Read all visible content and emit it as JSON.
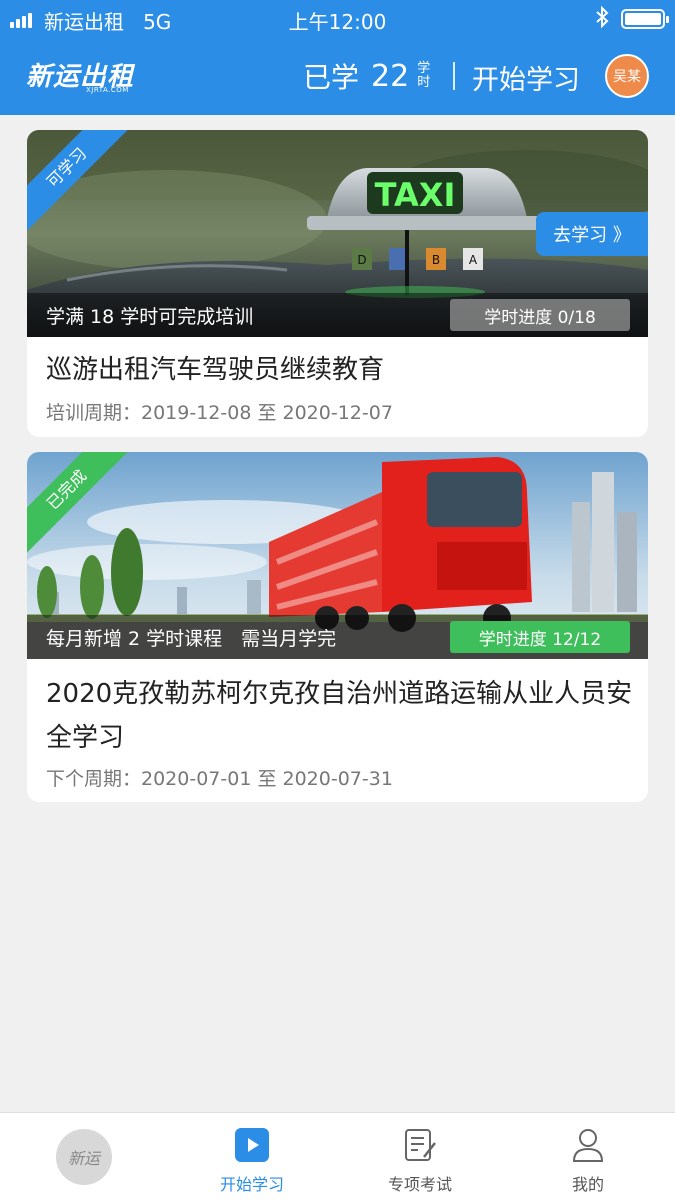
{
  "status_bar": {
    "carrier": "新运出租",
    "network": "5G",
    "time": "上午12:00",
    "bluetooth_icon": "bluetooth-icon",
    "battery_level": 1.0
  },
  "header": {
    "logo_text": "新运出租",
    "logo_sub": "XJRTA.COM",
    "learned_label": "已学",
    "learned_hours": "22",
    "learned_unit_top": "学",
    "learned_unit_bottom": "时",
    "start_label": "开始学习",
    "avatar_text": "吴某",
    "brand_color": "#2b8de6"
  },
  "courses": [
    {
      "ribbon": "可学习",
      "ribbon_color": "#2b8de6",
      "go_label": "去学习 》",
      "strip_text": "学满 18 学时可完成培训",
      "progress_label": "学时进度 0/18",
      "progress": 0.0,
      "title": "巡游出租汽车驾驶员继续教育",
      "period": "培训周期：2019-12-08 至 2020-12-07",
      "taxi_sign": "TAXI",
      "sign_letters": [
        "D",
        "B",
        "A"
      ]
    },
    {
      "ribbon": "已完成",
      "ribbon_color": "#3fbf5c",
      "strip_text": "每月新增 2 学时课程　需当月学完",
      "progress_label": "学时进度 12/12",
      "progress": 1.0,
      "title": "2020克孜勒苏柯尔克孜自治州道路运输从业人员安全学习",
      "period": "下个周期：2020-07-01 至 2020-07-31"
    }
  ],
  "tabbar": {
    "home_badge": "新运",
    "items": [
      {
        "label": "开始学习",
        "icon": "play-icon",
        "active": true
      },
      {
        "label": "专项考试",
        "icon": "exam-icon",
        "active": false
      },
      {
        "label": "我的",
        "icon": "user-icon",
        "active": false
      }
    ]
  }
}
